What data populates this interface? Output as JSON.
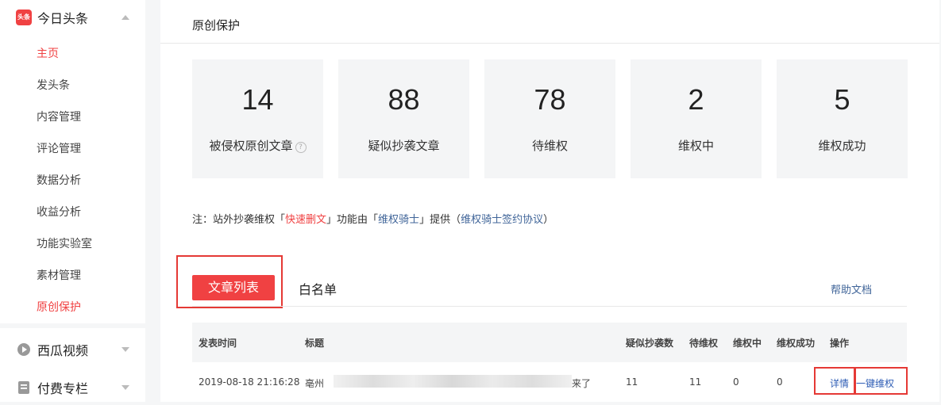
{
  "sidebar": {
    "toutiao": {
      "label": "今日头条",
      "icon_text": "头条"
    },
    "items": [
      {
        "label": "主页",
        "active": true
      },
      {
        "label": "发头条"
      },
      {
        "label": "内容管理"
      },
      {
        "label": "评论管理"
      },
      {
        "label": "数据分析"
      },
      {
        "label": "收益分析"
      },
      {
        "label": "功能实验室"
      },
      {
        "label": "素材管理"
      },
      {
        "label": "原创保护",
        "active": true
      }
    ],
    "xigua": {
      "label": "西瓜视频"
    },
    "paid": {
      "label": "付费专栏"
    }
  },
  "page": {
    "title": "原创保护"
  },
  "stats": [
    {
      "value": "14",
      "label": "被侵权原创文章"
    },
    {
      "value": "88",
      "label": "疑似抄袭文章"
    },
    {
      "value": "78",
      "label": "待维权"
    },
    {
      "value": "2",
      "label": "维权中"
    },
    {
      "value": "5",
      "label": "维权成功"
    }
  ],
  "note": {
    "prefix": "注：站外抄袭维权「",
    "quick": "快速删文",
    "mid": "」功能由「",
    "knight": "维权骑士",
    "suffix": "」提供（",
    "agreement": "维权骑士签约协议",
    "end": "）"
  },
  "tabs": {
    "article_list": "文章列表",
    "whitelist": "白名单",
    "help": "帮助文档"
  },
  "table": {
    "headers": [
      "发表时间",
      "标题",
      "疑似抄袭数",
      "待维权",
      "维权中",
      "维权成功",
      "操作"
    ],
    "row": {
      "time": "2019-08-18 21:16:28",
      "title_start": "亳州",
      "title_end": "来了",
      "suspected": "11",
      "pending": "11",
      "in_progress": "0",
      "success": "0",
      "detail": "详情",
      "one_click": "一键维权"
    }
  },
  "colors": {
    "accent": "#f04142",
    "link": "#406599",
    "highlight_box": "#e53935"
  }
}
